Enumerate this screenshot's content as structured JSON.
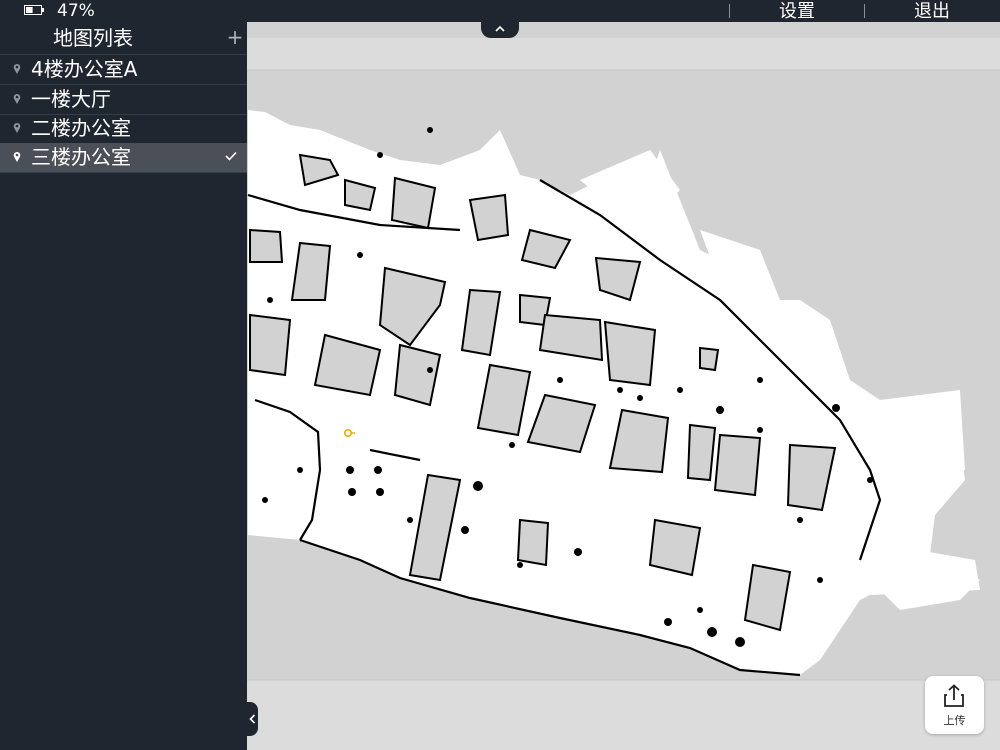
{
  "status_bar": {
    "battery_percent": "47%",
    "battery_level": 0.47,
    "settings_label": "设置",
    "logout_label": "退出"
  },
  "sidebar": {
    "title": "地图列表",
    "add_symbol": "+",
    "items": [
      {
        "label": "4楼办公室A",
        "selected": false
      },
      {
        "label": "一楼大厅",
        "selected": false
      },
      {
        "label": "二楼办公室",
        "selected": false
      },
      {
        "label": "三楼办公室",
        "selected": true
      }
    ]
  },
  "map": {
    "name": "三楼办公室",
    "unknown_color": "#d2d2d2",
    "free_color": "#ffffff",
    "obstacle_color": "#000000",
    "robot_marker_color": "#f0a800"
  },
  "upload_button": {
    "label": "上传",
    "icon": "share-upload-icon"
  },
  "icons": {
    "battery": "battery-icon",
    "pin": "map-pin-icon",
    "check": "checkmark-icon",
    "expand_top": "chevron-up-icon",
    "collapse_sidebar": "chevron-left-icon"
  }
}
